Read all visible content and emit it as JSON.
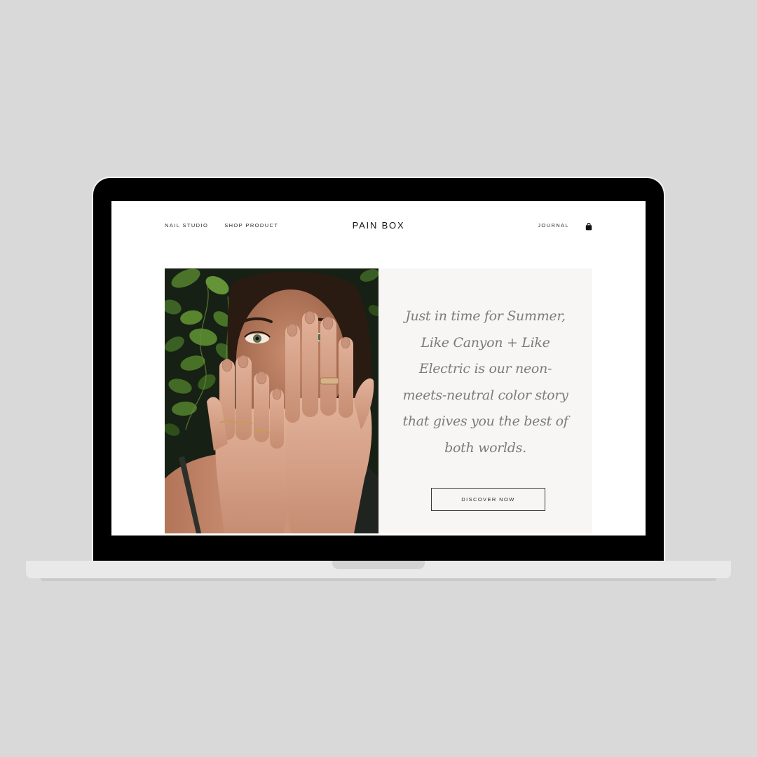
{
  "nav": {
    "left": [
      "NAIL STUDIO",
      "SHOP PRODUCT"
    ],
    "brand": "PAIN BOX",
    "right": "JOURNAL",
    "cart_icon": "shopping-bag-icon"
  },
  "hero": {
    "tagline": "Just in time for Summer, Like Canyon + Like Electric is our neon-meets-neutral color story that gives you the best of both worlds.",
    "cta_label": "DISCOVER NOW",
    "panel_color": "#f8f6f4"
  },
  "colors": {
    "background": "#d9d9d9",
    "bezel": "#000000",
    "text": "#2a2a2a",
    "tagline": "#7c7c7c"
  }
}
